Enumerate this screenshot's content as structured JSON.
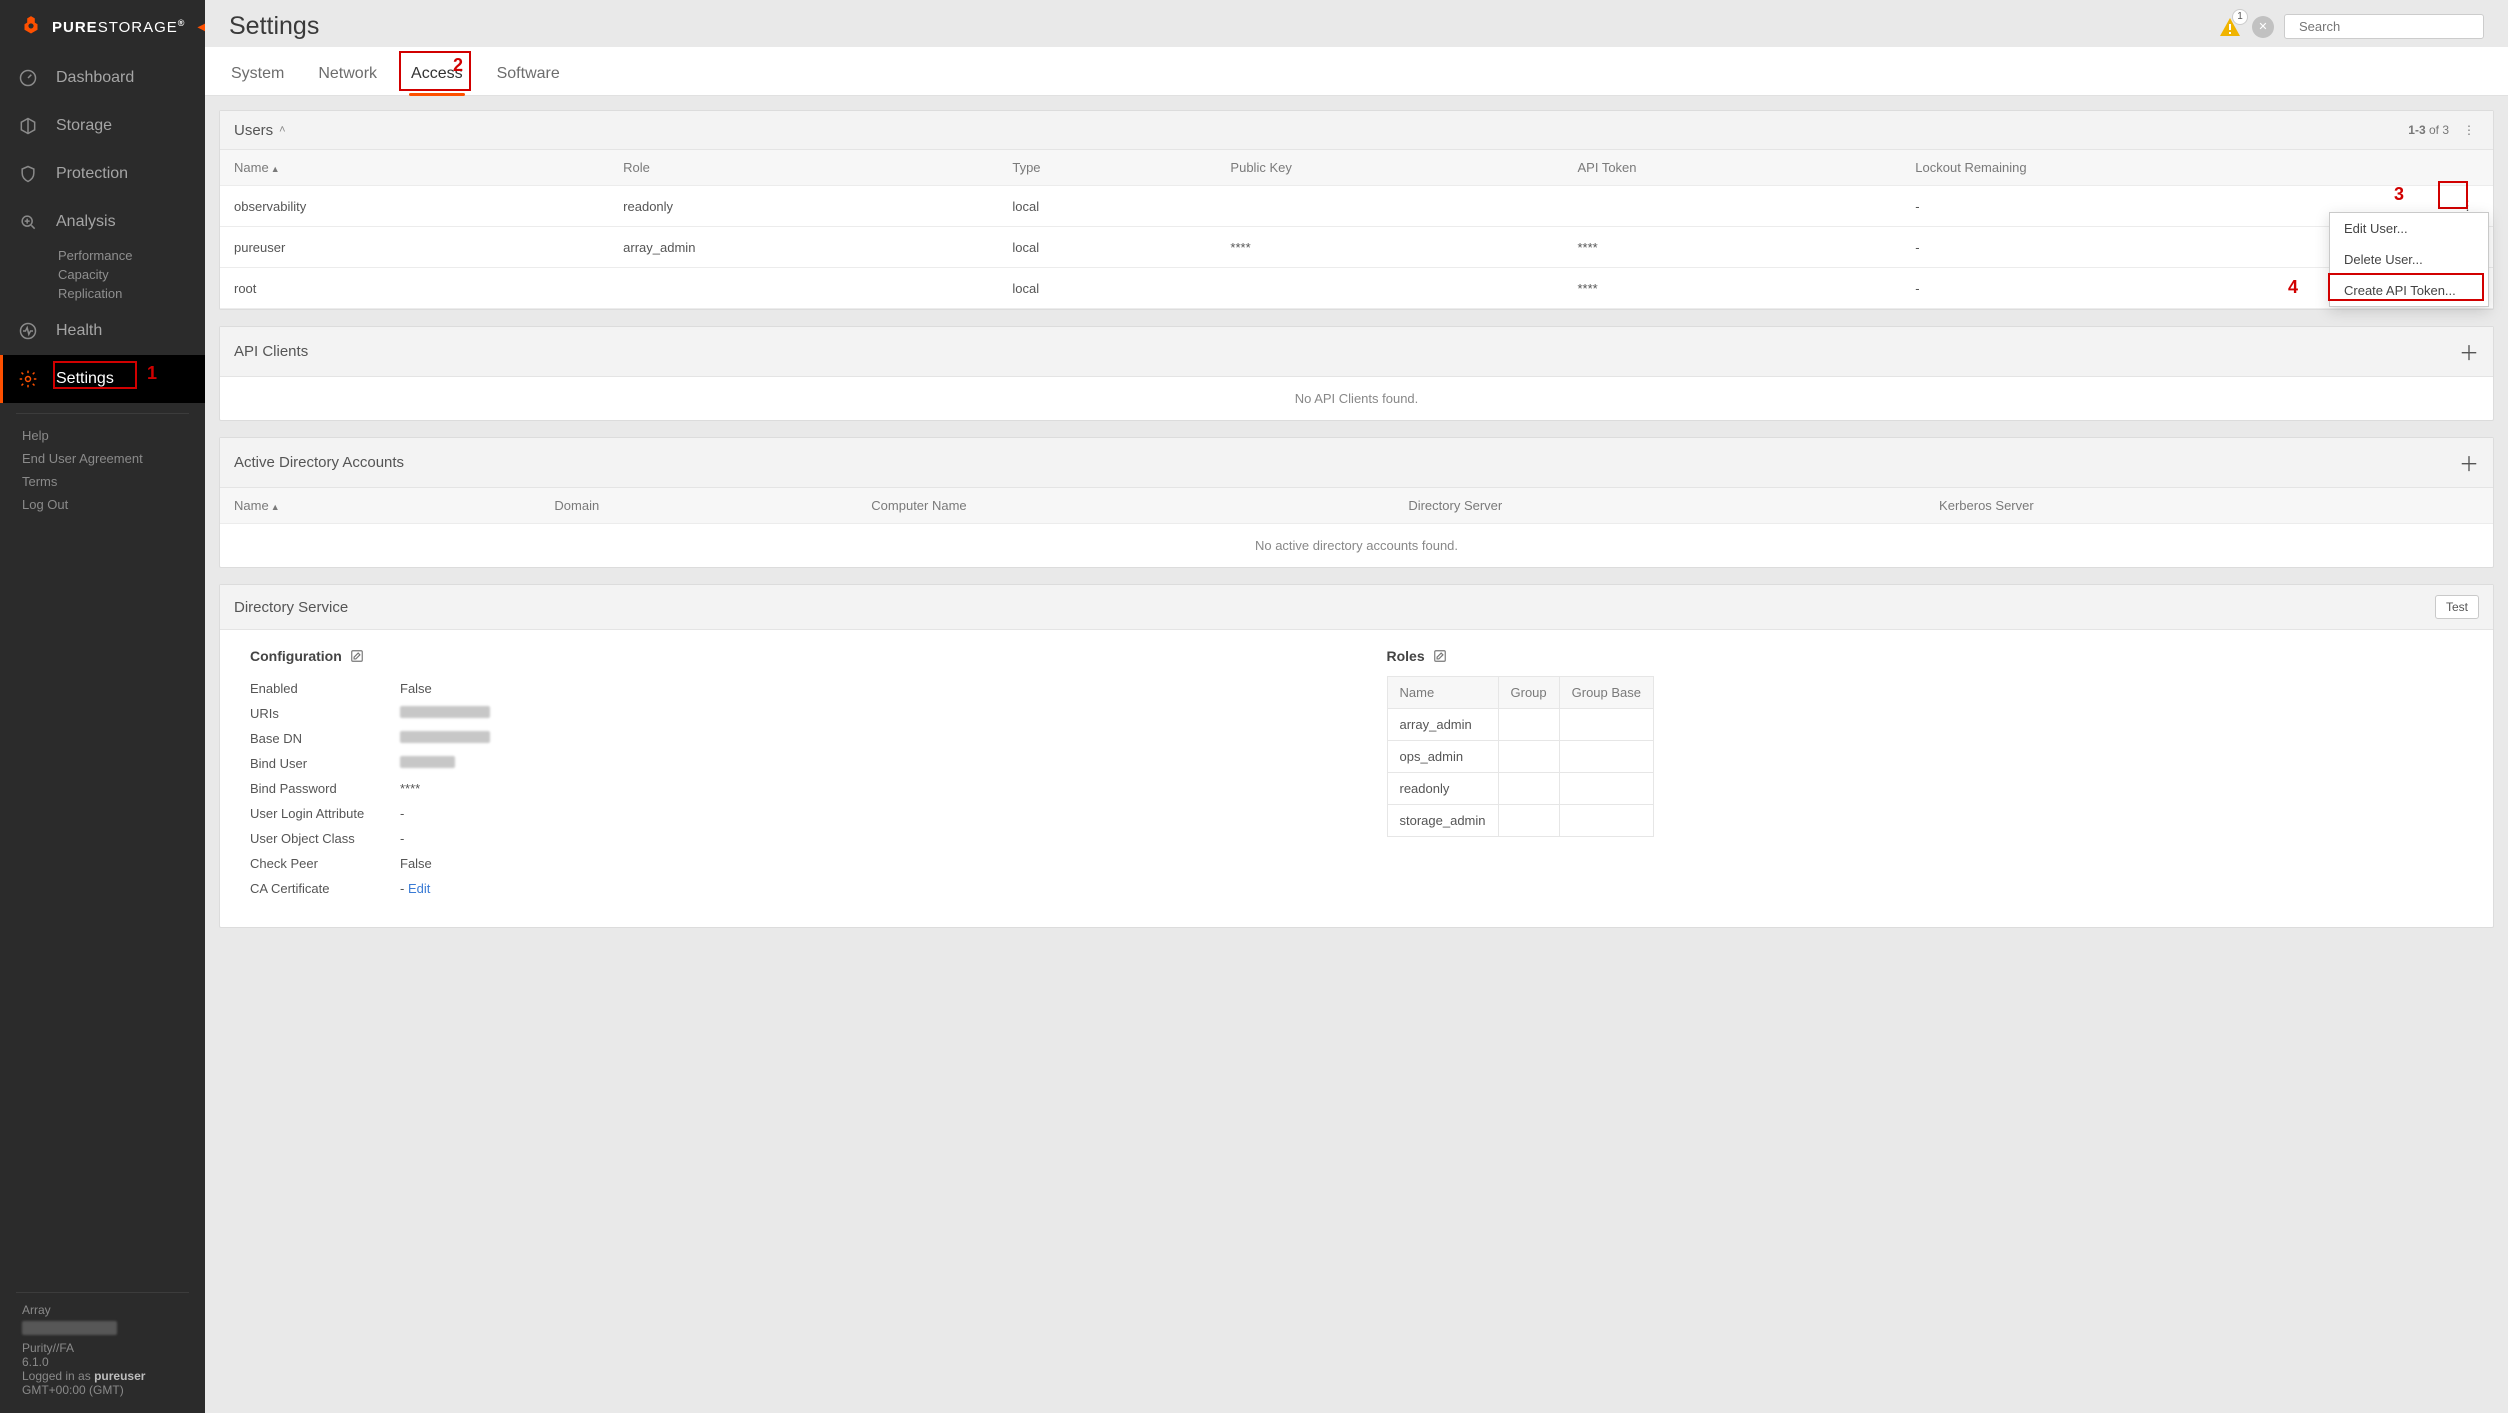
{
  "brand": {
    "name_bold": "PURE",
    "name_thin": "STORAGE",
    "trademark": "®"
  },
  "sidebar": {
    "items": [
      {
        "label": "Dashboard"
      },
      {
        "label": "Storage"
      },
      {
        "label": "Protection"
      },
      {
        "label": "Analysis",
        "subs": [
          "Performance",
          "Capacity",
          "Replication"
        ]
      },
      {
        "label": "Health"
      },
      {
        "label": "Settings",
        "active": true
      }
    ],
    "links": [
      "Help",
      "End User Agreement",
      "Terms",
      "Log Out"
    ],
    "array": {
      "title": "Array",
      "product": "Purity//FA",
      "version": "6.1.0",
      "logged_in_prefix": "Logged in as ",
      "logged_in_user": "pureuser",
      "tz": "GMT+00:00 (GMT)"
    }
  },
  "annotations": {
    "n1": "1",
    "n2": "2",
    "n3": "3",
    "n4": "4"
  },
  "page": {
    "title": "Settings"
  },
  "alerts": {
    "count": "1"
  },
  "search": {
    "placeholder": "Search"
  },
  "tabs": [
    "System",
    "Network",
    "Access",
    "Software"
  ],
  "active_tab": "Access",
  "users_panel": {
    "title": "Users",
    "paging_prefix": "1-3",
    "paging_of": " of ",
    "paging_total": "3",
    "columns": [
      "Name",
      "Role",
      "Type",
      "Public Key",
      "API Token",
      "Lockout Remaining"
    ],
    "rows": [
      {
        "name": "observability",
        "role": "readonly",
        "type": "local",
        "pk": "",
        "token": "",
        "lockout": "-"
      },
      {
        "name": "pureuser",
        "role": "array_admin",
        "type": "local",
        "pk": "****",
        "token": "****",
        "lockout": "-"
      },
      {
        "name": "root",
        "role": "",
        "type": "local",
        "pk": "",
        "token": "****",
        "lockout": "-"
      }
    ],
    "menu": [
      "Edit User...",
      "Delete User...",
      "Create API Token..."
    ]
  },
  "api_clients": {
    "title": "API Clients",
    "empty": "No API Clients found."
  },
  "ad_accounts": {
    "title": "Active Directory Accounts",
    "columns": [
      "Name",
      "Domain",
      "Computer Name",
      "Directory Server",
      "Kerberos Server"
    ],
    "empty": "No active directory accounts found."
  },
  "dir_service": {
    "title": "Directory Service",
    "test": "Test",
    "config_title": "Configuration",
    "roles_title": "Roles",
    "fields": {
      "enabled_k": "Enabled",
      "enabled_v": "False",
      "uris_k": "URIs",
      "basedn_k": "Base DN",
      "binduser_k": "Bind User",
      "bindpw_k": "Bind Password",
      "bindpw_v": "****",
      "login_k": "User Login Attribute",
      "login_v": "-",
      "objclass_k": "User Object Class",
      "objclass_v": "-",
      "checkpeer_k": "Check Peer",
      "checkpeer_v": "False",
      "cacert_k": "CA Certificate",
      "cacert_v": "Edit"
    },
    "role_cols": [
      "Name",
      "Group",
      "Group Base"
    ],
    "roles": [
      "array_admin",
      "ops_admin",
      "readonly",
      "storage_admin"
    ]
  }
}
